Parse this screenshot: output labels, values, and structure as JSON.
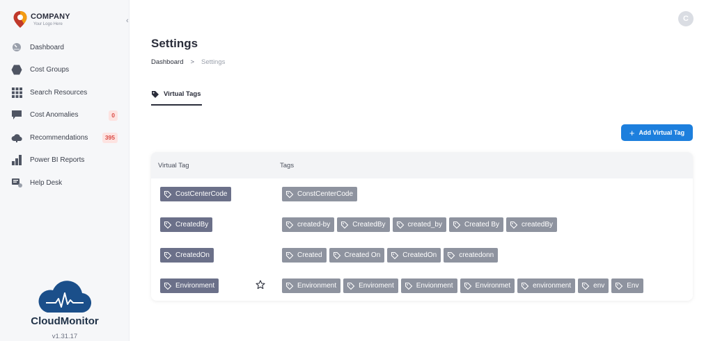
{
  "logo": {
    "title": "COMPANY",
    "subtitle": "Your Logo Here"
  },
  "sidebar": {
    "items": [
      {
        "label": "Dashboard",
        "icon": "gauge-icon"
      },
      {
        "label": "Cost Groups",
        "icon": "hexagon-icon"
      },
      {
        "label": "Search Resources",
        "icon": "grid-icon"
      },
      {
        "label": "Cost Anomalies",
        "icon": "chat-icon",
        "badge": "0"
      },
      {
        "label": "Recommendations",
        "icon": "cloud-icon",
        "badge": "395"
      },
      {
        "label": "Power BI Reports",
        "icon": "bar-chart-icon"
      },
      {
        "label": "Help Desk",
        "icon": "helpdesk-icon"
      }
    ]
  },
  "brand": {
    "name": "CloudMonitor",
    "version": "v1.31.17"
  },
  "header": {
    "avatar_letter": "C"
  },
  "page": {
    "title": "Settings"
  },
  "breadcrumb": {
    "home": "Dashboard",
    "separator": ">",
    "current": "Settings"
  },
  "tabs": [
    {
      "label": "Virtual Tags"
    }
  ],
  "actions": {
    "add_label": "Add Virtual Tag"
  },
  "table": {
    "headers": {
      "virtual_tag": "Virtual Tag",
      "tags": "Tags"
    },
    "rows": [
      {
        "virtual_tag": "CostCenterCode",
        "tags": [
          "ConstCenterCode"
        ]
      },
      {
        "virtual_tag": "CreatedBy",
        "tags": [
          "created-by",
          "CreatedBy",
          "created_by",
          "Created By",
          "createdBy"
        ]
      },
      {
        "virtual_tag": "CreatedOn",
        "tags": [
          "Created",
          "Created On",
          "CreatedOn",
          "createdonn"
        ]
      },
      {
        "virtual_tag": "Environment",
        "tags": [
          "Environment",
          "Enviroment",
          "Envionment",
          "Environmet",
          "environment",
          "env",
          "Env"
        ],
        "starred": false
      }
    ]
  },
  "colors": {
    "accent": "#1d7fdd",
    "virtual_chip": "#6b7089",
    "tag_chip": "#8e939f",
    "badge_text": "#d94b45",
    "badge_bg": "#fde3e1"
  }
}
